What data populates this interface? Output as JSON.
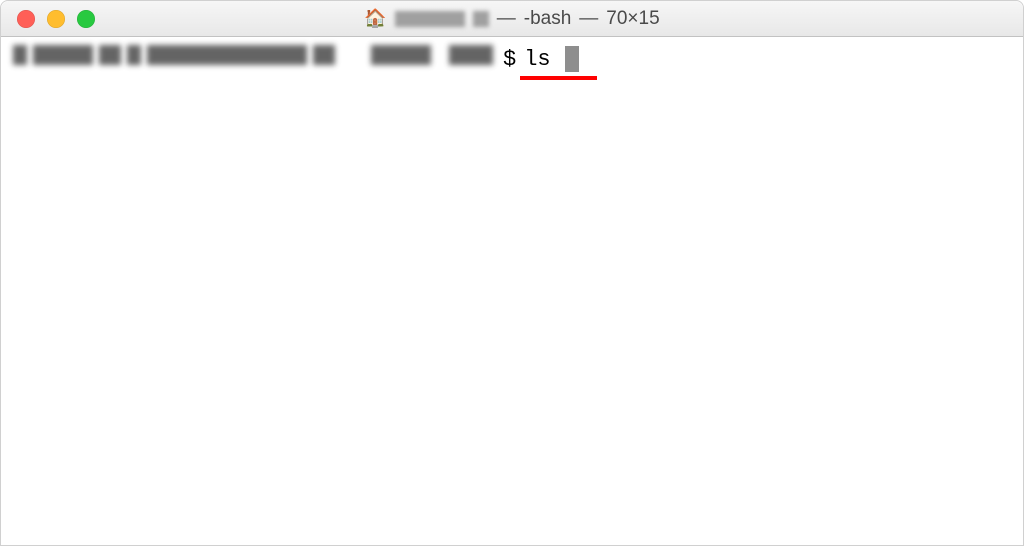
{
  "window": {
    "title_dash_1": "—",
    "process": "-bash",
    "title_dash_2": "—",
    "dimensions": "70×15"
  },
  "terminal": {
    "prompt_symbol": "$",
    "command": "ls"
  }
}
